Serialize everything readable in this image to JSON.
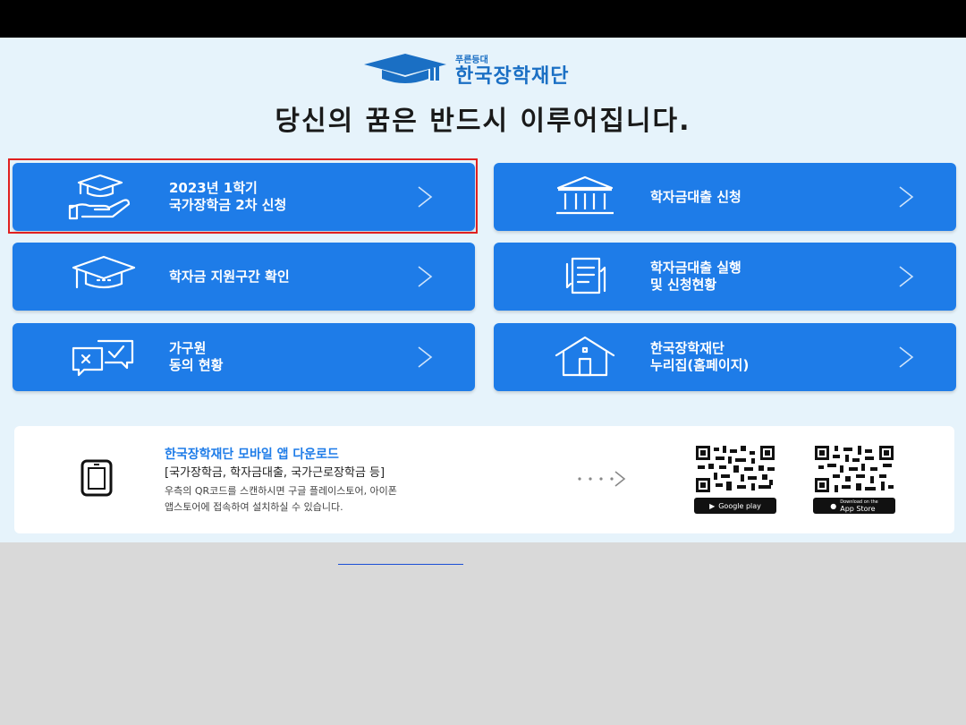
{
  "header": {
    "logo_sub": "푸른등대",
    "logo_main": "한국장학재단",
    "headline": "당신의 꿈은 반드시 이루어집니다."
  },
  "cards": [
    {
      "line1": "2023년 1학기",
      "line2": "국가장학금 2차 신청",
      "icon": "graduation-hand-icon",
      "highlighted": true
    },
    {
      "line1": "학자금대출 신청",
      "line2": "",
      "icon": "bank-icon",
      "highlighted": false
    },
    {
      "line1": "학자금 지원구간 확인",
      "line2": "",
      "icon": "graduation-cap-icon",
      "highlighted": false
    },
    {
      "line1": "학자금대출 실행",
      "line2": "및 신청현황",
      "icon": "document-cycle-icon",
      "highlighted": false
    },
    {
      "line1": "가구원",
      "line2": "동의 현황",
      "icon": "consent-chat-icon",
      "highlighted": false
    },
    {
      "line1": "한국장학재단",
      "line2": "누리집(홈페이지)",
      "icon": "house-icon",
      "highlighted": false
    }
  ],
  "app": {
    "title": "한국장학재단 모바일 앱 다운로드",
    "subtitle": "[국가장학금, 학자금대출, 국가근로장학금 등]",
    "desc1": "우측의 QR코드를 스캔하시면 구글 플레이스토어, 아이폰",
    "desc2": "앱스토어에 접속하여 설치하실 수 있습니다.",
    "google_badge": "Google play",
    "apple_badge": "App Store",
    "apple_badge_small": "Download on the"
  },
  "colors": {
    "card": "#1e7ce8",
    "panel": "#e6f3fb",
    "highlight": "#e02020",
    "brand": "#1a6fc4"
  }
}
